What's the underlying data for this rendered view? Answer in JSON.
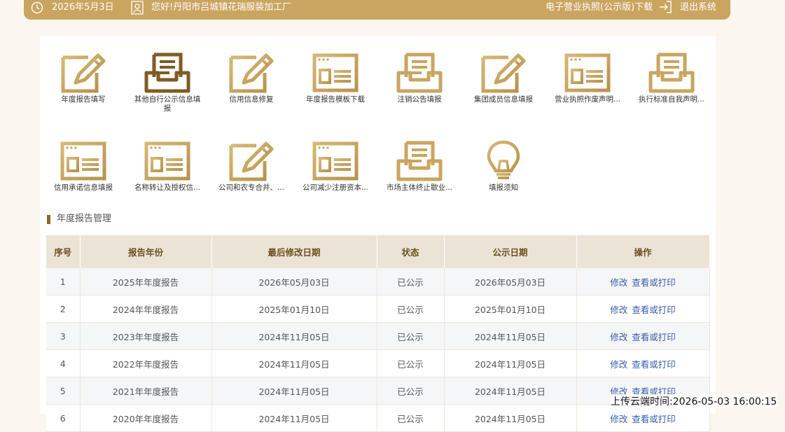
{
  "topbar": {
    "date": "2026年5月3日",
    "greeting": "您好!丹阳市吕城镇花瑞服装加工厂",
    "license_download": "电子营业执照(公示版)下载",
    "logout": "退出系统"
  },
  "tiles": [
    {
      "label": "年度报告填写",
      "icon": "edit-doc-icon"
    },
    {
      "label": "其他自行公示信息填报",
      "icon": "inbox-icon"
    },
    {
      "label": "信用信息修复",
      "icon": "edit-doc-icon"
    },
    {
      "label": "年度报告模板下载",
      "icon": "window-list-icon"
    },
    {
      "label": "注销公告填报",
      "icon": "inbox-icon"
    },
    {
      "label": "集团成员信息填报",
      "icon": "edit-doc-icon"
    },
    {
      "label": "营业执照作废声明...",
      "icon": "window-list-icon"
    },
    {
      "label": "执行标准自我声明...",
      "icon": "inbox-icon"
    },
    {
      "label": "信用承诺信息填报",
      "icon": "window-list-icon"
    },
    {
      "label": "名称转让及授权信...",
      "icon": "window-list-icon"
    },
    {
      "label": "公司和农专合并、...",
      "icon": "edit-doc-icon"
    },
    {
      "label": "公司减少注册资本...",
      "icon": "window-list-icon"
    },
    {
      "label": "市场主体终止歇业...",
      "icon": "inbox-icon"
    },
    {
      "label": "填报须知",
      "icon": "lightbulb-icon"
    }
  ],
  "section": {
    "title": "年度报告管理"
  },
  "table": {
    "headers": [
      "序号",
      "报告年份",
      "最后修改日期",
      "状态",
      "公示日期",
      "操作"
    ],
    "action_edit": "修改",
    "action_view": "查看或打印",
    "rows": [
      [
        "1",
        "2025年年度报告",
        "2026年05月03日",
        "已公示",
        "2026年05月03日"
      ],
      [
        "2",
        "2024年年度报告",
        "2025年01月10日",
        "已公示",
        "2025年01月10日"
      ],
      [
        "3",
        "2023年年度报告",
        "2024年11月05日",
        "已公示",
        "2024年11月05日"
      ],
      [
        "4",
        "2022年年度报告",
        "2024年11月05日",
        "已公示",
        "2024年11月05日"
      ],
      [
        "5",
        "2021年年度报告",
        "2024年11月05日",
        "已公示",
        "2024年11月05日"
      ],
      [
        "6",
        "2020年年度报告",
        "2024年11月05日",
        "已公示",
        "2024年11月05日"
      ]
    ]
  },
  "upload_time": "上传云端时间:2026-05-03 16:00:15",
  "colors": {
    "gold": "#c9a560",
    "gold_dark": "#8a6a2c",
    "header_bg": "#ece3d7",
    "link": "#3a5ea8"
  }
}
